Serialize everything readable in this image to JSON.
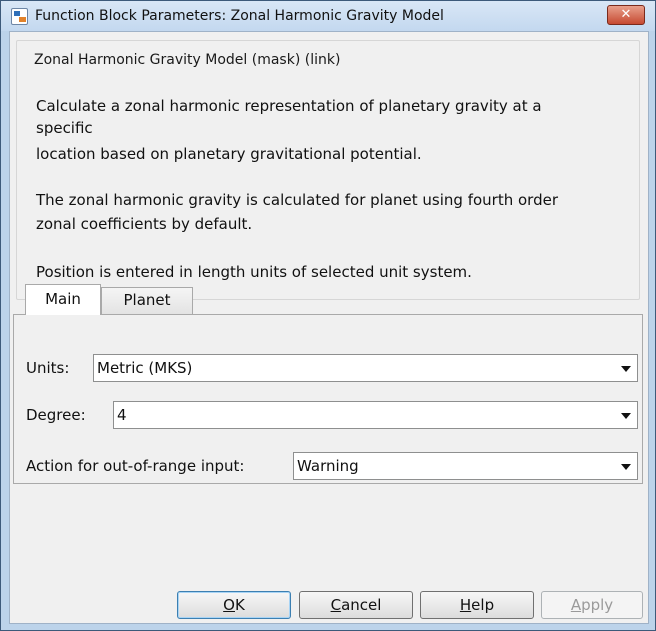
{
  "window": {
    "title": "Function Block Parameters: Zonal Harmonic Gravity Model",
    "close_glyph": "✕",
    "app_icon": "simulink-block-icon"
  },
  "description": {
    "group_title": "Zonal Harmonic Gravity Model (mask) (link)",
    "lines": [
      "Calculate a zonal harmonic representation of planetary gravity at a",
      "specific",
      "location based on planetary gravitational potential.",
      "The zonal harmonic gravity is calculated for planet using fourth order",
      "zonal coefficients by default.",
      "Position is entered in length units of selected unit system."
    ]
  },
  "tabs": [
    {
      "label": "Main",
      "active": true
    },
    {
      "label": "Planet",
      "active": false
    }
  ],
  "params": {
    "units": {
      "label": "Units:",
      "value": "Metric (MKS)"
    },
    "degree": {
      "label": "Degree:",
      "value": "4"
    },
    "action": {
      "label": "Action for out-of-range input:",
      "value": "Warning"
    }
  },
  "buttons": {
    "ok": {
      "first": "O",
      "rest": "K"
    },
    "cancel": {
      "first": "C",
      "rest": "ancel"
    },
    "help": {
      "first": "H",
      "rest": "elp"
    },
    "apply": {
      "first": "A",
      "rest": "pply"
    }
  }
}
